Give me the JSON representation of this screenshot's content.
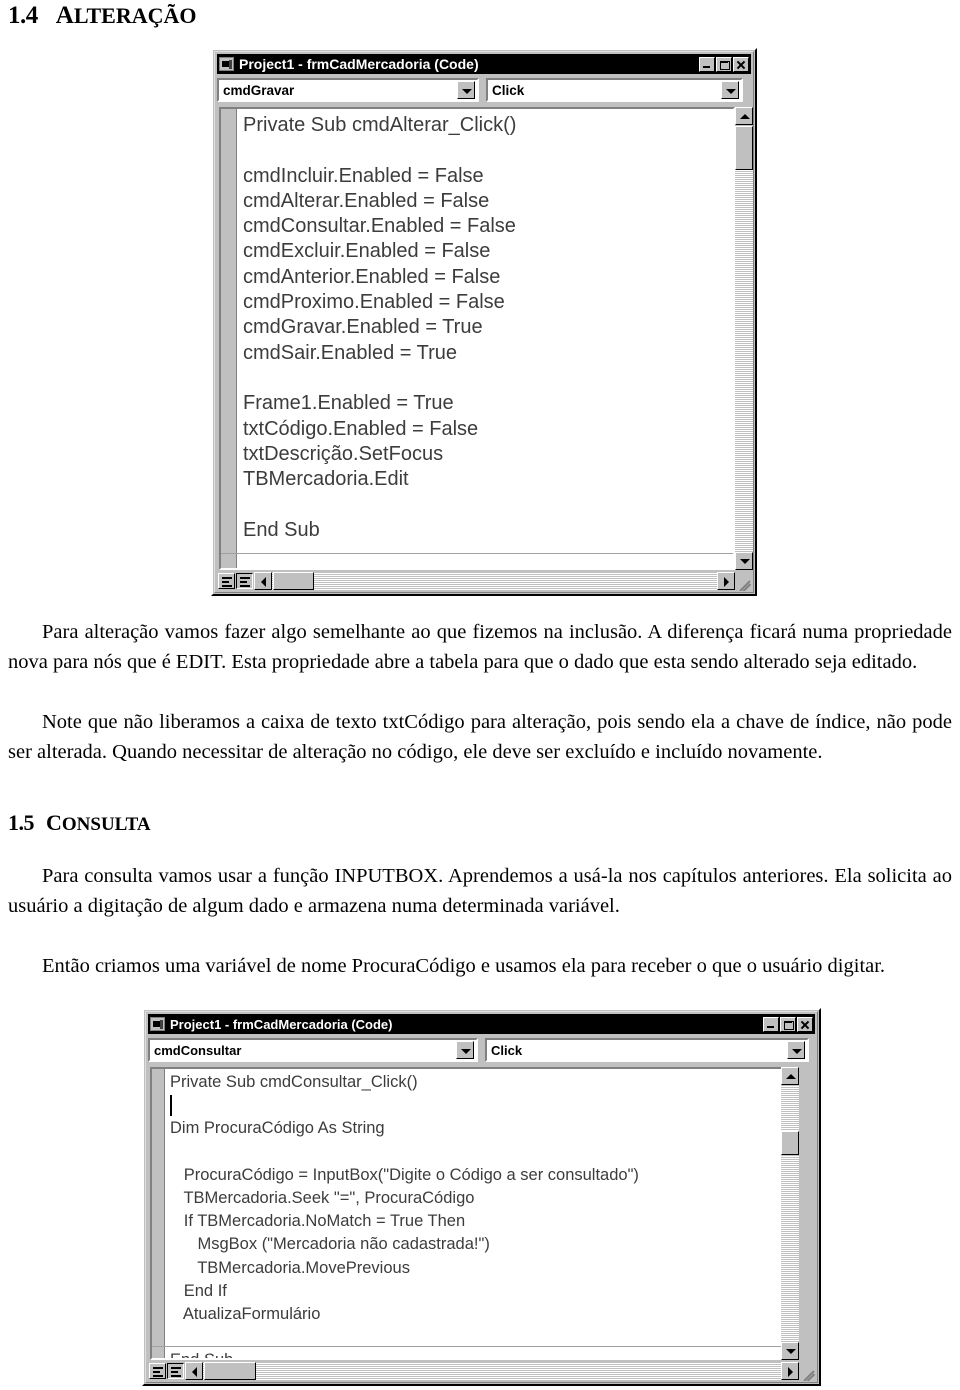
{
  "document": {
    "sections": [
      {
        "number": "1.4",
        "title_first": "A",
        "title_rest": "LTERAÇÃO"
      },
      {
        "number": "1.5",
        "title_first": "C",
        "title_rest": "ONSULTA"
      }
    ],
    "paragraphs": [
      "Para alteração vamos fazer algo semelhante ao que fizemos na inclusão. A diferença ficará numa propriedade nova para nós que é EDIT. Esta propriedade abre a tabela para que o dado que esta sendo alterado seja editado.",
      "Note que não liberamos a caixa de texto txtCódigo para alteração, pois sendo ela a chave de índice, não pode ser alterada. Quando necessitar de alteração no código, ele deve ser excluído e incluído novamente.",
      "Para consulta vamos usar a função INPUTBOX. Aprendemos a usá-la nos capítulos anteriores. Ela solicita ao usuário a digitação de algum dado e armazena numa determinada variável.",
      "Então criamos uma variável de nome ProcuraCódigo e usamos ela para receber o que o usuário digitar."
    ]
  },
  "window1": {
    "title": "Project1 - frmCadMercadoria (Code)",
    "object_combo": "cmdGravar",
    "procedure_combo": "Click",
    "buttons": {
      "minimize": "Minimize",
      "maximize": "Maximize",
      "close": "Close"
    },
    "code_lines": [
      "Private Sub cmdAlterar_Click()",
      "",
      "cmdIncluir.Enabled = False",
      "cmdAlterar.Enabled = False",
      "cmdConsultar.Enabled = False",
      "cmdExcluir.Enabled = False",
      "cmdAnterior.Enabled = False",
      "cmdProximo.Enabled = False",
      "cmdGravar.Enabled = True",
      "cmdSair.Enabled = True",
      "",
      "Frame1.Enabled = True",
      "txtCódigo.Enabled = False",
      "txtDescrição.SetFocus",
      "TBMercadoria.Edit",
      "",
      "End Sub"
    ],
    "view_buttons": {
      "procedure_view": "Procedure View",
      "full_module_view": "Full Module View"
    }
  },
  "window2": {
    "title": "Project1 - frmCadMercadoria (Code)",
    "object_combo": "cmdConsultar",
    "procedure_combo": "Click",
    "buttons": {
      "minimize": "Minimize",
      "maximize": "Maximize",
      "close": "Close"
    },
    "code_lines": [
      "Private Sub cmdConsultar_Click()",
      "",
      "Dim ProcuraCódigo As String",
      "",
      "   ProcuraCódigo = InputBox(\"Digite o Código a ser consultado\")",
      "   TBMercadoria.Seek \"=\", ProcuraCódigo",
      "   If TBMercadoria.NoMatch = True Then",
      "      MsgBox (\"Mercadoria não cadastrada!\")",
      "      TBMercadoria.MovePrevious",
      "   End If",
      "   AtualizaFormulário",
      "",
      "End Sub"
    ],
    "view_buttons": {
      "procedure_view": "Procedure View",
      "full_module_view": "Full Module View"
    }
  }
}
